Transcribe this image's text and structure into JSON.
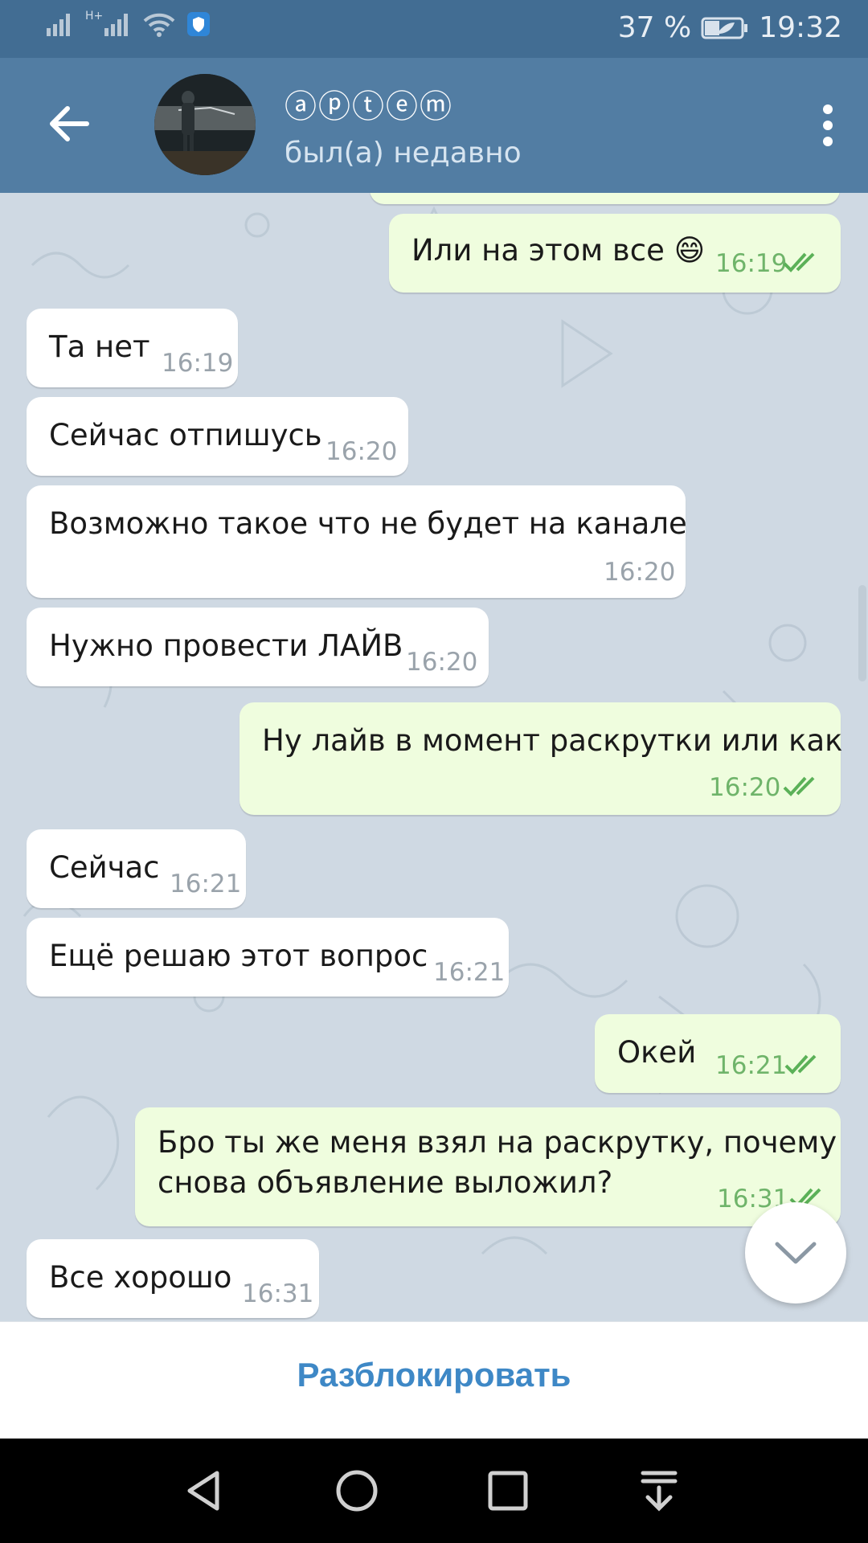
{
  "status_bar": {
    "network": "H+",
    "battery_percent": "37 %",
    "time": "19:32"
  },
  "header": {
    "contact_name": "ⓐⓟⓣⓔⓜ",
    "contact_status": "был(а) недавно"
  },
  "messages": [
    {
      "direction": "out",
      "text": "Или на этом все 😄",
      "time": "16:19"
    },
    {
      "direction": "in",
      "text": "Та нет",
      "time": "16:19"
    },
    {
      "direction": "in",
      "text": "Сейчас отпишусь",
      "time": "16:20"
    },
    {
      "direction": "in",
      "text": "Возможно такое что не будет на канале",
      "time": "16:20"
    },
    {
      "direction": "in",
      "text": "Нужно провести ЛАЙВ",
      "time": "16:20"
    },
    {
      "direction": "out",
      "text": "Ну лайв в момент раскрутки или как",
      "time": "16:20"
    },
    {
      "direction": "in",
      "text": "Сейчас",
      "time": "16:21"
    },
    {
      "direction": "in",
      "text": "Ещё решаю этот вопрос",
      "time": "16:21"
    },
    {
      "direction": "out",
      "text": "Окей",
      "time": "16:21"
    },
    {
      "direction": "out",
      "text_line1": "Бро ты же меня взял на раскрутку, почему",
      "text_line2": "снова объявление выложил?",
      "time": "16:31"
    },
    {
      "direction": "in",
      "text": "Все хорошо",
      "time": "16:31"
    }
  ],
  "bottom_action": {
    "label": "Разблокировать"
  },
  "colors": {
    "header": "#527da3",
    "status_bar": "#426d93",
    "chat_background": "#cfd9e3",
    "incoming_bubble": "#ffffff",
    "outgoing_bubble": "#effdde",
    "accent_link": "#3e88c6",
    "read_check": "#5bb158"
  },
  "icons": [
    "signal-icon",
    "wifi-icon",
    "shield-icon",
    "battery-icon",
    "back-arrow-icon",
    "more-vert-icon",
    "read-checks-icon",
    "chevron-down-icon",
    "nav-back-icon",
    "nav-home-icon",
    "nav-recents-icon",
    "nav-notifications-icon"
  ]
}
